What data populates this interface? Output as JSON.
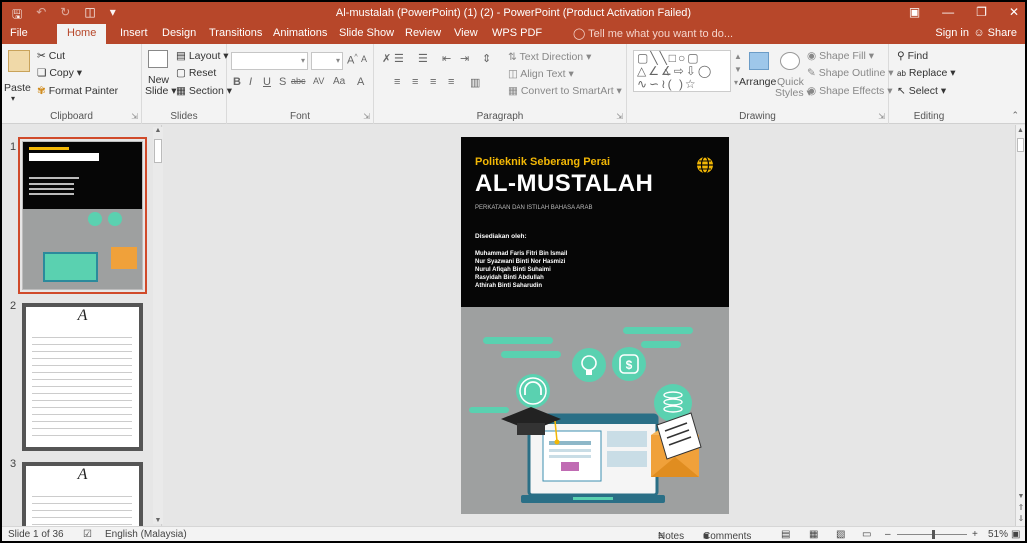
{
  "window": {
    "title": "Al-mustalah (PowerPoint) (1) (2) - PowerPoint (Product Activation Failed)"
  },
  "tabs": [
    "File",
    "Home",
    "Insert",
    "Design",
    "Transitions",
    "Animations",
    "Slide Show",
    "Review",
    "View",
    "WPS PDF"
  ],
  "active_tab": "Home",
  "tell_me": "Tell me what you want to do...",
  "signin": "Sign in",
  "share": "Share",
  "ribbon": {
    "clipboard": {
      "label": "Clipboard",
      "paste": "Paste",
      "cut": "Cut",
      "copy": "Copy",
      "format_painter": "Format Painter"
    },
    "slides": {
      "label": "Slides",
      "new_slide_1": "New",
      "new_slide_2": "Slide",
      "layout": "Layout",
      "reset": "Reset",
      "section": "Section"
    },
    "font": {
      "label": "Font"
    },
    "paragraph": {
      "label": "Paragraph",
      "text_direction": "Text Direction",
      "align_text": "Align Text",
      "convert_smartart": "Convert to SmartArt"
    },
    "drawing": {
      "label": "Drawing",
      "arrange": "Arrange",
      "quick_1": "Quick",
      "quick_2": "Styles",
      "shape_fill": "Shape Fill",
      "shape_outline": "Shape Outline",
      "shape_effects": "Shape Effects"
    },
    "editing": {
      "label": "Editing",
      "find": "Find",
      "replace": "Replace",
      "select": "Select"
    }
  },
  "thumbnails": [
    {
      "number": "1"
    },
    {
      "number": "2",
      "letter": "A"
    },
    {
      "number": "3",
      "letter": "A"
    }
  ],
  "slide": {
    "org": "Politeknik Seberang Perai",
    "title": "AL-MUSTALAH",
    "subtitle": "PERKATAAN DAN ISTILAH BAHASA ARAB",
    "prepared_by": "Disediakan oleh:",
    "names": [
      "Muhammad Faris Fitri Bin Ismail",
      "Nur Syazwani Binti Nor Hasmizi",
      "Nurul Afiqah Binti Suhaimi",
      "Rasyidah Binti Abdullah",
      "Athirah Binti Saharudin"
    ]
  },
  "status": {
    "slide_count": "Slide 1 of 36",
    "language": "English (Malaysia)",
    "notes": "Notes",
    "comments": "Comments",
    "zoom": "51%"
  },
  "colors": {
    "accent": "#b7472a",
    "slide_dark": "#060606",
    "slide_gray": "#9ea0a0",
    "teal": "#5ad1b0",
    "orange": "#f0a13a"
  }
}
